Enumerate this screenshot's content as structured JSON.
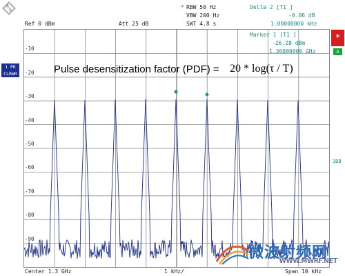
{
  "header": {
    "rbw": "RBW 50 Hz",
    "vbw": "VBW 200 Hz",
    "swt": "SWT 4.8 s",
    "ref": "Ref  0 dBm",
    "att": "Att  25 dB",
    "marker_star": "*"
  },
  "delta": {
    "title": "Delta 2 [T1 ]",
    "level": "-0.06 dB",
    "freq": "1.00000000 kHz"
  },
  "marker": {
    "title": "Marker 1 [T1 ]",
    "level": "-26.28 dBm",
    "freq": "1.30000000 GHz"
  },
  "trace": {
    "line1": "1 PK",
    "line2": "CLRWR"
  },
  "side": {
    "star": "*",
    "a_label": "A",
    "threshold": "3DB"
  },
  "annotation": {
    "text": "Pulse desensitization factor (PDF) =",
    "formula": "20 * log(τ / T)"
  },
  "y_axis": {
    "ticks": [
      "-10",
      "-20",
      "-30",
      "-40",
      "-50",
      "-60",
      "-70",
      "-80",
      "-90"
    ]
  },
  "footer": {
    "center": "Center  1.3 GHz",
    "div": "1 kHz/",
    "span": "Span  10 kHz"
  },
  "watermark": {
    "text": "微波射频网",
    "url": "WWW.MWRF.NET"
  },
  "colors": {
    "trace": "#1d2f8f",
    "teal": "#1a8a8a",
    "grid": "#8a8a8a"
  }
}
